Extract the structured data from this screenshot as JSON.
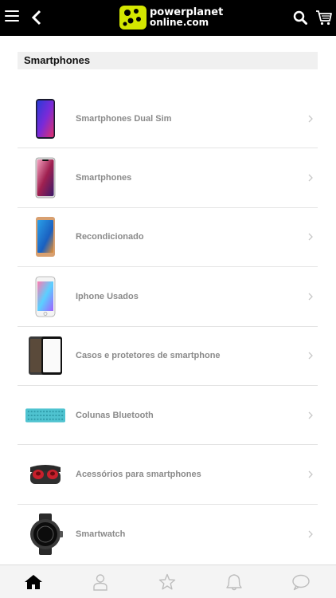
{
  "header": {
    "logo_line1": "powerplanet",
    "logo_line2": "online.com",
    "menu_icon": "hamburger-icon",
    "back_icon": "chevron-left-icon",
    "search_icon": "search-icon",
    "cart_icon": "cart-icon"
  },
  "section": {
    "title": "Smartphones"
  },
  "categories": [
    {
      "label": "Smartphones Dual Sim",
      "icon": "phone-image"
    },
    {
      "label": "Smartphones",
      "icon": "phone-image"
    },
    {
      "label": "Recondicionado",
      "icon": "phone-image"
    },
    {
      "label": "Iphone Usados",
      "icon": "phone-image"
    },
    {
      "label": "Casos e protetores de smartphone",
      "icon": "screen-protector-image"
    },
    {
      "label": "Colunas Bluetooth",
      "icon": "speaker-image"
    },
    {
      "label": "Acessórios para smartphones",
      "icon": "earbuds-image"
    },
    {
      "label": "Smartwatch",
      "icon": "smartwatch-image"
    }
  ],
  "bottom_nav": [
    {
      "name": "home-icon",
      "active": true
    },
    {
      "name": "user-icon",
      "active": false
    },
    {
      "name": "star-icon",
      "active": false
    },
    {
      "name": "bell-icon",
      "active": false
    },
    {
      "name": "chat-icon",
      "active": false
    }
  ],
  "colors": {
    "topbar": "#000000",
    "brand_accent": "#d4e600",
    "section_bg": "#f0f0f0",
    "item_text": "#8a8a8a"
  }
}
